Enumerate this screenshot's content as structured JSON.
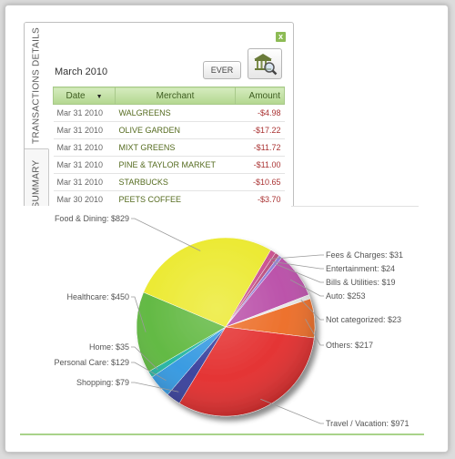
{
  "tabs": {
    "transactions_details": "TRANSACTIONS DETAILS",
    "summary": "SUMMARY"
  },
  "header": {
    "period": "March 2010",
    "ever_button": "EVER",
    "close_icon": "x"
  },
  "table": {
    "columns": {
      "date": "Date",
      "merchant": "Merchant",
      "amount": "Amount"
    },
    "rows": [
      {
        "date": "Mar 31 2010",
        "merchant": "WALGREENS",
        "amount": "-$4.98"
      },
      {
        "date": "Mar 31 2010",
        "merchant": "OLIVE GARDEN",
        "amount": "-$17.22"
      },
      {
        "date": "Mar 31 2010",
        "merchant": "MIXT GREENS",
        "amount": "-$11.72"
      },
      {
        "date": "Mar 31 2010",
        "merchant": "PINE & TAYLOR MARKET",
        "amount": "-$11.00"
      },
      {
        "date": "Mar 31 2010",
        "merchant": "STARBUCKS",
        "amount": "-$10.65"
      },
      {
        "date": "Mar 30 2010",
        "merchant": "PEETS COFFEE",
        "amount": "-$3.70"
      }
    ]
  },
  "chart_data": {
    "type": "pie",
    "slices": [
      {
        "label": "Fees & Charges: $31",
        "value": 31,
        "color": "#c94b8c"
      },
      {
        "label": "Entertainment: $24",
        "value": 24,
        "color": "#b84a7a"
      },
      {
        "label": "Bills & Utilities: $19",
        "value": 19,
        "color": "#8c7bd6"
      },
      {
        "label": "Auto: $253",
        "value": 253,
        "color": "#b84aa6"
      },
      {
        "label": "Not categorized: $23",
        "value": 23,
        "color": "#e6e6e6"
      },
      {
        "label": "Others: $217",
        "value": 217,
        "color": "#ec6a22"
      },
      {
        "label": "Travel / Vacation: $971",
        "value": 971,
        "color": "#e32a2a"
      },
      {
        "label": "Shopping: $79",
        "value": 79,
        "color": "#343c9a"
      },
      {
        "label": "Personal Care: $129",
        "value": 129,
        "color": "#2f96e0"
      },
      {
        "label": "Home: $35",
        "value": 35,
        "color": "#1fb3a0"
      },
      {
        "label": "Healthcare: $450",
        "value": 450,
        "color": "#5bb63a"
      },
      {
        "label": "Food & Dining: $829",
        "value": 829,
        "color": "#ebe92a"
      }
    ]
  }
}
